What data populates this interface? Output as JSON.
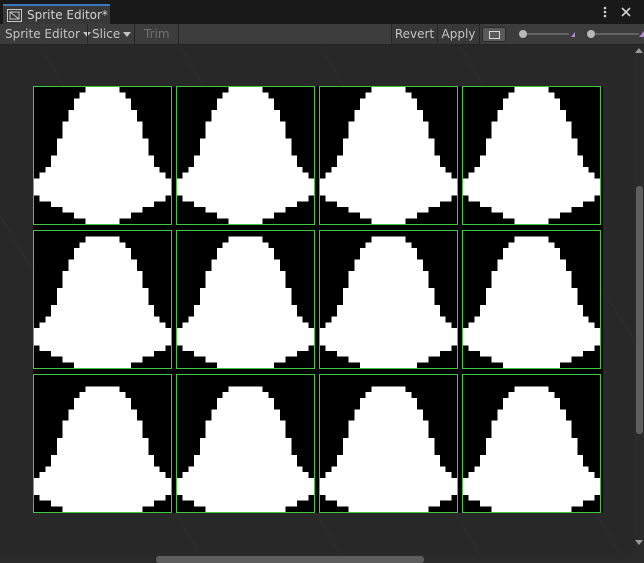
{
  "window": {
    "tab_title": "Sprite Editor*",
    "tab_icon": "sprite-editor-icon",
    "menu_icon": "kebab-menu-icon",
    "close_icon": "close-icon"
  },
  "toolbar": {
    "editor_mode_label": "Sprite Editor",
    "slice_label": "Slice",
    "trim_label": "Trim",
    "revert_label": "Revert",
    "apply_label": "Apply",
    "alpha_toggle_icon": "alpha-channel-icon",
    "zoom_slider_icon": "zoom-slider-icon",
    "mip_slider_icon": "mip-level-icon",
    "zoom_level": 0.0,
    "mip_level": 0.0
  },
  "sprite_sheet": {
    "rows": 3,
    "columns": 4,
    "slice_color": "#3ec93e",
    "sprite_color": "#ffffff",
    "background_color": "#000000"
  },
  "colors": {
    "accent_tab": "#3a79bb",
    "panel_background": "#282828",
    "toolbar_background": "#3c3c3c"
  }
}
